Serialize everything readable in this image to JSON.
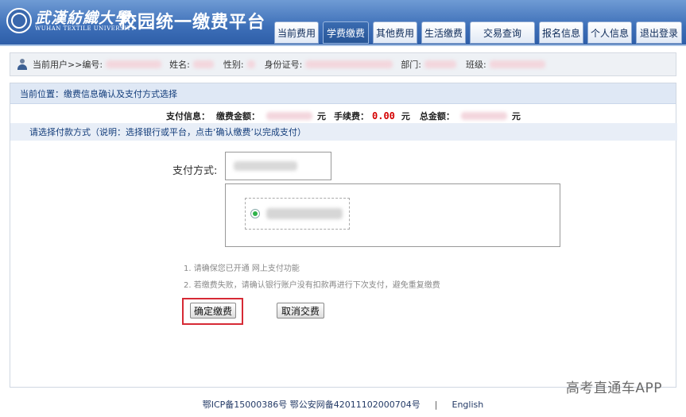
{
  "header": {
    "logo_cn": "武漢紡織大學",
    "logo_en": "WUHAN TEXTILE UNIVERSITY",
    "title": "校园统一缴费平台",
    "nav": [
      {
        "label": "当前费用",
        "active": false
      },
      {
        "label": "学费缴费",
        "active": true
      },
      {
        "label": "其他费用",
        "active": false
      },
      {
        "label": "生活缴费",
        "active": false
      },
      {
        "label": "交易查询",
        "active": false
      },
      {
        "label": "报名信息",
        "active": false
      },
      {
        "label": "个人信息",
        "active": false
      },
      {
        "label": "退出登录",
        "active": false
      }
    ]
  },
  "userbar": {
    "current_user": "当前用户>>编号:",
    "name": "姓名:",
    "gender": "性别:",
    "id_card": "身份证号:",
    "dept": "部门:",
    "class": "班级:"
  },
  "breadcrumb": "当前位置：缴费信息确认及支付方式选择",
  "payinfo": {
    "label": "支付信息：",
    "amount_label": "缴费金额：",
    "fee_label": "手续费：",
    "fee_value": "0.00",
    "total_label": "总金额：",
    "unit": "元"
  },
  "select_hint": "请选择付款方式（说明：选择银行或平台，点击‘确认缴费’以完成支付）",
  "pay_method_label": "支付方式:",
  "notes": [
    "1. 请确保您已开通 网上支付功能",
    "2. 若缴费失败，请确认银行账户没有扣款再进行下次支付，避免重复缴费"
  ],
  "buttons": {
    "confirm": "确定缴费",
    "cancel": "取消交费"
  },
  "footer": {
    "icp": "鄂ICP备15000386号 鄂公安网备42011102000704号",
    "sep": "|",
    "lang": "English"
  },
  "watermark": "高考直通车APP"
}
